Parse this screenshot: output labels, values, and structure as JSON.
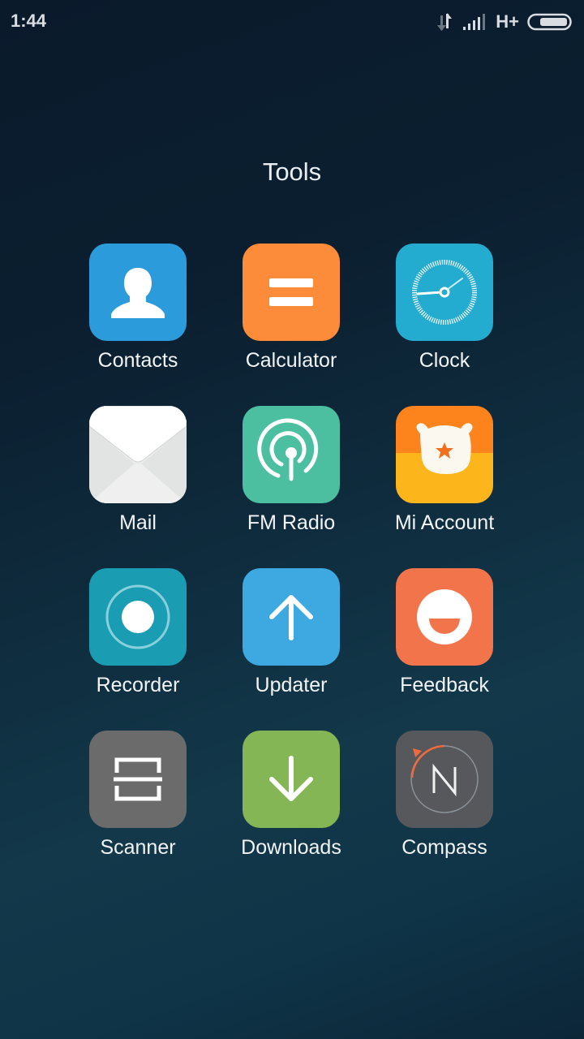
{
  "status_bar": {
    "time": "1:44",
    "network_type": "H+",
    "icons": [
      "data-transfer-icon",
      "signal-strength-icon",
      "battery-icon"
    ]
  },
  "folder": {
    "title": "Tools",
    "apps": [
      {
        "label": "Contacts",
        "icon": "contacts-icon",
        "color": "#2b9bdb"
      },
      {
        "label": "Calculator",
        "icon": "calculator-icon",
        "color": "#fd8c3a"
      },
      {
        "label": "Clock",
        "icon": "clock-icon",
        "color": "#24acd0"
      },
      {
        "label": "Mail",
        "icon": "mail-icon",
        "color": "#f3f3f3"
      },
      {
        "label": "FM Radio",
        "icon": "radio-icon",
        "color": "#4bbfa0"
      },
      {
        "label": "Mi Account",
        "icon": "mi-account-icon",
        "color": "#fd841c"
      },
      {
        "label": "Recorder",
        "icon": "recorder-icon",
        "color": "#1a9db2"
      },
      {
        "label": "Updater",
        "icon": "updater-icon",
        "color": "#3da9e0"
      },
      {
        "label": "Feedback",
        "icon": "feedback-icon",
        "color": "#f2744a"
      },
      {
        "label": "Scanner",
        "icon": "scanner-icon",
        "color": "#6b6b6b"
      },
      {
        "label": "Downloads",
        "icon": "downloads-icon",
        "color": "#84b656"
      },
      {
        "label": "Compass",
        "icon": "compass-icon",
        "color": "#56585c"
      }
    ]
  }
}
